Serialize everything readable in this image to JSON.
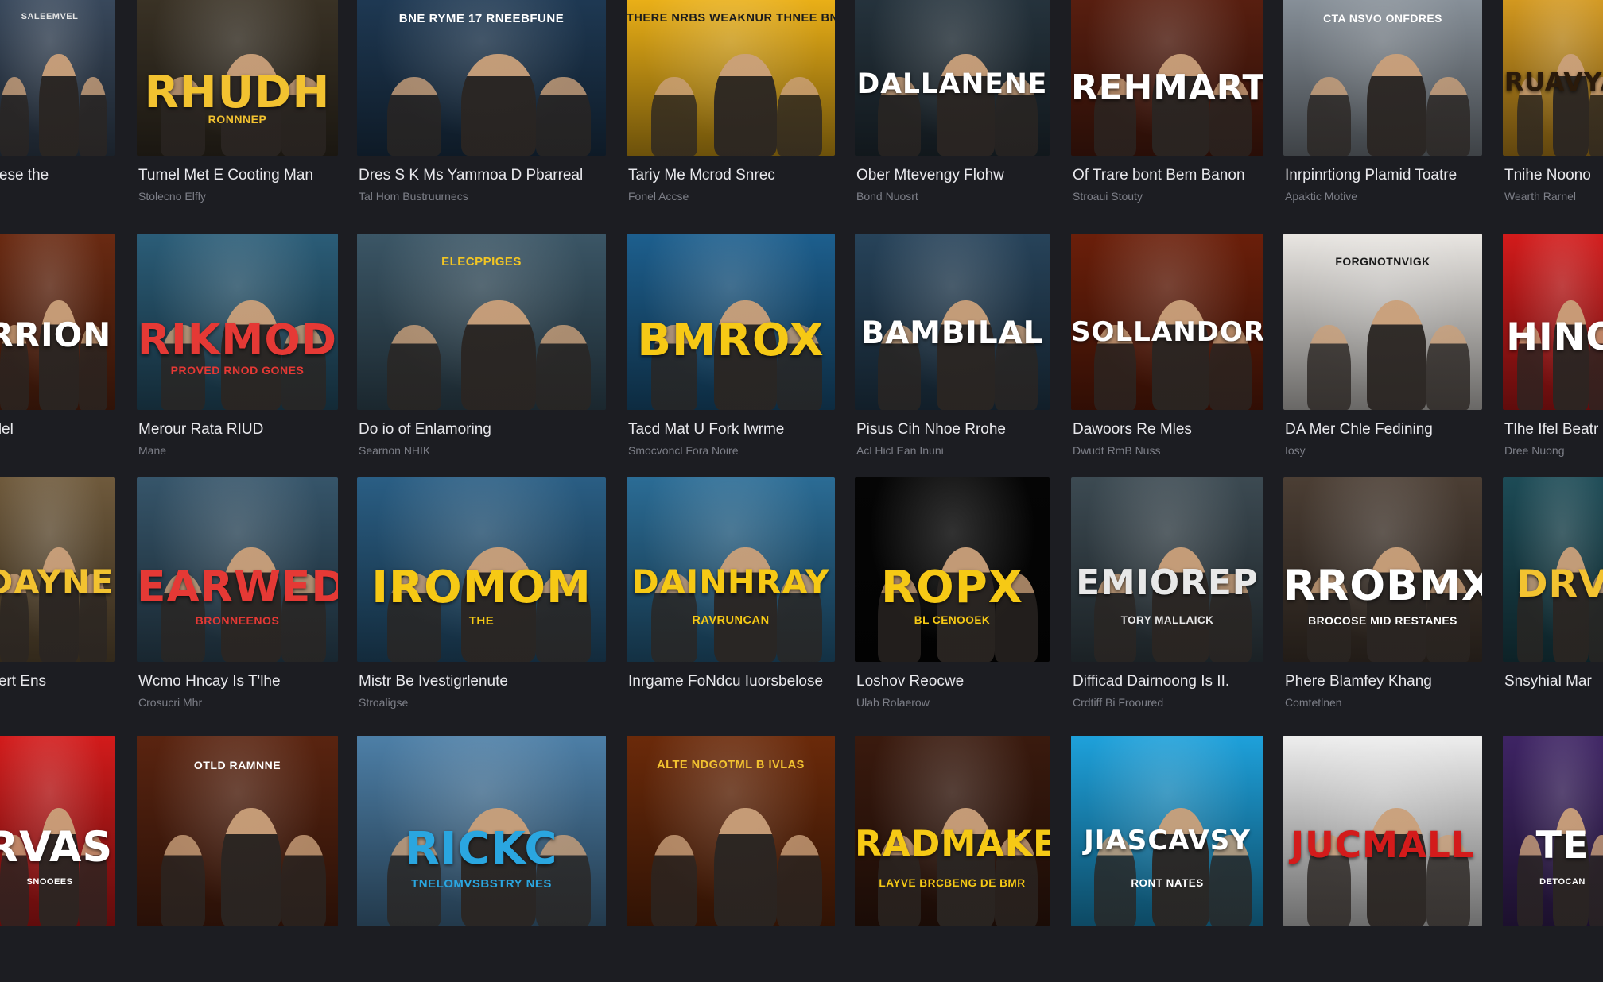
{
  "rows": [
    {
      "items": [
        {
          "poster_title": "",
          "tagline": "SALEEMVEL",
          "label": "Alese the",
          "sub": "",
          "bg": "#3a4a5e",
          "accent": "#e6e6e6"
        },
        {
          "poster_title": "RHUDH",
          "tagline": "RONNNEP",
          "label": "Tumel Met E Cooting Man",
          "sub": "Stolecno Elfly",
          "bg": "#3b3326",
          "accent": "#f2c230"
        },
        {
          "poster_title": "",
          "tagline": "BNE RYME 17 RNEEBFUNE",
          "label": "Dres S K Ms Yammoa D Pbarreal",
          "sub": "Tal Hom Bustruurnecs",
          "bg": "#1f3a55",
          "accent": "#ffffff"
        },
        {
          "poster_title": "",
          "tagline": "THERE NRBS WEAKNUR THNEE BNDEL STERMES",
          "label": "Tariy Me Mcrod Snrec",
          "sub": "Fonel Accse",
          "bg": "#f0b418",
          "accent": "#1b1b1b"
        },
        {
          "poster_title": "DALLANENE",
          "tagline": "",
          "label": "Ober Mtevengy Flohw",
          "sub": "Bond Nuosrt",
          "bg": "#26343e",
          "accent": "#ffffff"
        },
        {
          "poster_title": "REHMART",
          "tagline": "",
          "label": "Of Trare bont Bem Banon",
          "sub": "Stroaui Stouty",
          "bg": "#5a1f10",
          "accent": "#ffffff"
        },
        {
          "poster_title": "",
          "tagline": "CTA NSVO ONFDRES",
          "label": "Inrpinrtiong Plamid Toatre",
          "sub": "Apaktic Motive",
          "bg": "#8a939c",
          "accent": "#ffffff"
        },
        {
          "poster_title": "RUAVYA",
          "tagline": "",
          "label": "Tnihe Noono",
          "sub": "Wearth Rarnel",
          "bg": "#d89c20",
          "accent": "#2a1a0a"
        }
      ]
    },
    {
      "items": [
        {
          "poster_title": "RRION",
          "tagline": "",
          "label": "Mlel",
          "sub": "",
          "bg": "#6a2a12",
          "accent": "#ffffff"
        },
        {
          "poster_title": "RIKMOD",
          "tagline": "PROVED RNOD GONES",
          "label": "Merour Rata RIUD",
          "sub": "Mane",
          "bg": "#2b5d78",
          "accent": "#e53935"
        },
        {
          "poster_title": "",
          "tagline": "ELECPPIGES",
          "label": "Do io of Enlamoring",
          "sub": "Searnon NHIK",
          "bg": "#3b5666",
          "accent": "#f3c623"
        },
        {
          "poster_title": "BMROX",
          "tagline": "",
          "label": "Tacd Mat U Fork Iwrme",
          "sub": "Smocvoncl Fora Noire",
          "bg": "#1d5f8e",
          "accent": "#f6c915"
        },
        {
          "poster_title": "BAMBILAL",
          "tagline": "",
          "label": "Pisus Cih Nhoe Rrohe",
          "sub": "Acl Hicl Ean Inuni",
          "bg": "#27435a",
          "accent": "#ffffff"
        },
        {
          "poster_title": "SOLLANDOR",
          "tagline": "",
          "label": "Dawoors Re Mles",
          "sub": "Dwudt RmB Nuss",
          "bg": "#6b1f0a",
          "accent": "#ffffff"
        },
        {
          "poster_title": "",
          "tagline": "FORGNOTNVIGK",
          "label": "DA Mer Chle Fedining",
          "sub": "Iosy",
          "bg": "#e9e6e2",
          "accent": "#1a1a1a"
        },
        {
          "poster_title": "HINO",
          "tagline": "",
          "label": "Tlhe Ifel Beatr",
          "sub": "Dree Nuong",
          "bg": "#d31b1b",
          "accent": "#ffffff"
        }
      ]
    },
    {
      "items": [
        {
          "poster_title": "DAYNE",
          "tagline": "",
          "label": "ntert Ens",
          "sub": "",
          "bg": "#6f5a3c",
          "accent": "#f2c230"
        },
        {
          "poster_title": "EARWED",
          "tagline": "BRONNEENOS",
          "label": "Wcmo Hncay Is T'lhe",
          "sub": "Crosucri Mhr",
          "bg": "#36556a",
          "accent": "#e53935"
        },
        {
          "poster_title": "IROMOM",
          "tagline": "THE",
          "label": "Mistr Be Ivestigrlenute",
          "sub": "Stroaligse",
          "bg": "#2a5e84",
          "accent": "#f6c915"
        },
        {
          "poster_title": "DAINHRAY",
          "tagline": "RAVRUNCAN",
          "label": "Inrgame FoNdcu Iuorsbelose",
          "sub": "",
          "bg": "#2b6c95",
          "accent": "#f6c915"
        },
        {
          "poster_title": "ROPX",
          "tagline": "BL CENOOEK",
          "label": "Loshov Reocwe",
          "sub": "Ulab Rolaerow",
          "bg": "#050505",
          "accent": "#f6c915"
        },
        {
          "poster_title": "EMIOREP",
          "tagline": "TORY MALLAICK",
          "label": "Difficad Dairnoong Is II.",
          "sub": "Crdtiff Bi Frooured",
          "bg": "#3c4a52",
          "accent": "#e8e8e8"
        },
        {
          "poster_title": "RROBMX",
          "tagline": "BROCOSE MID RESTANES",
          "label": "Phere Blamfey Khang",
          "sub": "Comtetlnen",
          "bg": "#4b3e34",
          "accent": "#ffffff"
        },
        {
          "poster_title": "DRV",
          "tagline": "",
          "label": "Snsyhial Mar",
          "sub": "",
          "bg": "#1d4b56",
          "accent": "#f2c230"
        }
      ]
    },
    {
      "items": [
        {
          "poster_title": "RVAS",
          "tagline": "SNOOEES",
          "label": "",
          "sub": "",
          "bg": "#d31b1b",
          "accent": "#ffffff"
        },
        {
          "poster_title": "",
          "tagline": "OTLD RAMNNE",
          "label": "",
          "sub": "",
          "bg": "#5a2410",
          "accent": "#ffffff"
        },
        {
          "poster_title": "RICKC",
          "tagline": "TNELOMVSBSTRY NES",
          "label": "",
          "sub": "",
          "bg": "#4d7fa7",
          "accent": "#2aa6e0"
        },
        {
          "poster_title": "",
          "tagline": "ALTE NDGOTML B IVLAS",
          "label": "",
          "sub": "",
          "bg": "#6b2a0a",
          "accent": "#f2c230"
        },
        {
          "poster_title": "RADMAKE",
          "tagline": "LAYVE BRCBENG DE BMR",
          "label": "",
          "sub": "",
          "bg": "#3a1a0e",
          "accent": "#f6c915"
        },
        {
          "poster_title": "JIASCAVSY",
          "tagline": "RONT NATES",
          "label": "",
          "sub": "",
          "bg": "#1ea1db",
          "accent": "#ffffff"
        },
        {
          "poster_title": "JUCMALL",
          "tagline": "",
          "label": "",
          "sub": "",
          "bg": "#eeeeee",
          "accent": "#d31b1b"
        },
        {
          "poster_title": "TE",
          "tagline": "DETOCAN",
          "label": "",
          "sub": "",
          "bg": "#3e2464",
          "accent": "#ffffff"
        }
      ]
    }
  ]
}
